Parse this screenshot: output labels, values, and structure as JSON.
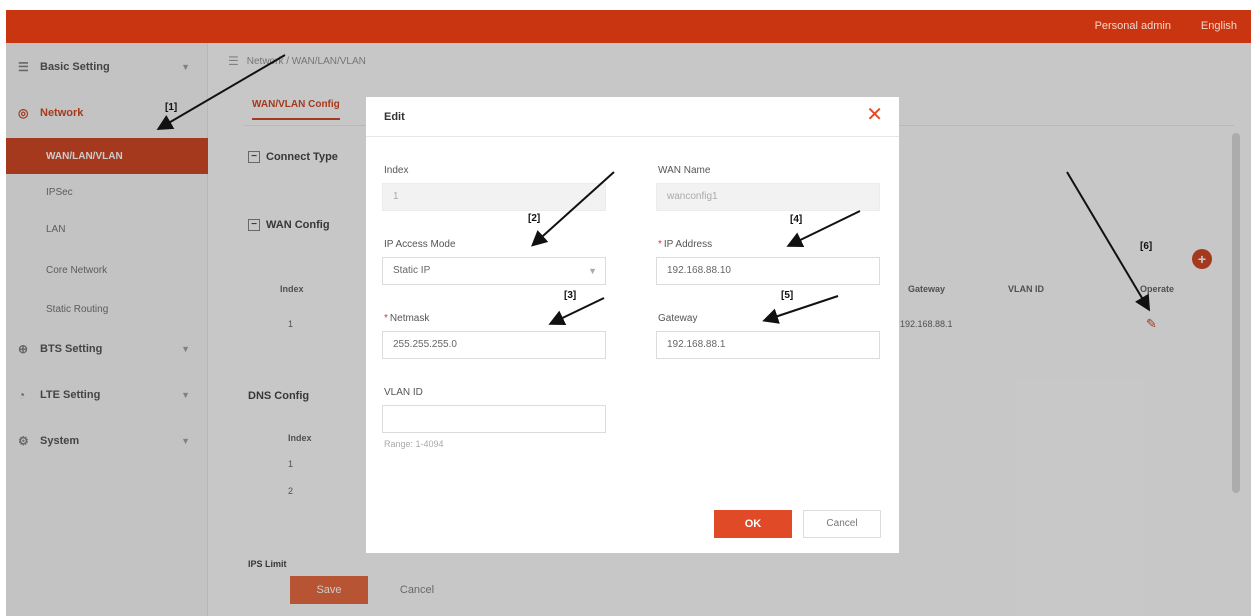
{
  "header": {
    "user": "Personal admin",
    "language": "English"
  },
  "sidebar": {
    "groups": [
      {
        "label": "Basic Setting",
        "icon": "settings-icon"
      },
      {
        "label": "Network",
        "icon": "network-icon"
      },
      {
        "label": "BTS Setting",
        "icon": "bts-icon"
      },
      {
        "label": "LTE Setting",
        "icon": "lte-icon"
      },
      {
        "label": "System",
        "icon": "system-icon"
      }
    ],
    "network_items": [
      "WAN/LAN/VLAN",
      "IPSec",
      "LAN",
      "Core Network",
      "Static Routing"
    ]
  },
  "content": {
    "breadcrumb": "Network / WAN/LAN/VLAN",
    "tab": "WAN/VLAN Config",
    "section1": "Connect Type",
    "section2": "WAN Config",
    "section3": "DNS Config",
    "section4": "IPS Limit",
    "wan_table": {
      "headers": [
        "Index",
        "Gateway",
        "VLAN ID",
        "Operate"
      ],
      "row_index": "1",
      "row_gateway": "192.168.88.1"
    },
    "dns_table": {
      "header": "Index",
      "rows": [
        "1",
        "2"
      ]
    },
    "save_label": "Save",
    "cancel_label": "Cancel"
  },
  "modal": {
    "title": "Edit",
    "index_label": "Index",
    "index_value": "1",
    "wan_name_label": "WAN Name",
    "wan_name_value": "wanconfig1",
    "ip_mode_label": "IP Access Mode",
    "ip_mode_value": "Static IP",
    "ip_address_label": "IP Address",
    "ip_address_value": "192.168.88.10",
    "netmask_label": "Netmask",
    "netmask_value": "255.255.255.0",
    "gateway_label": "Gateway",
    "gateway_value": "192.168.88.1",
    "vlan_label": "VLAN ID",
    "vlan_hint": "Range: 1-4094",
    "ok_label": "OK",
    "cancel_label": "Cancel"
  },
  "annotations": [
    "[1]",
    "[2]",
    "[3]",
    "[4]",
    "[5]",
    "[6]"
  ],
  "colors": {
    "brand": "#c93510",
    "ok_button": "#e04a26"
  }
}
